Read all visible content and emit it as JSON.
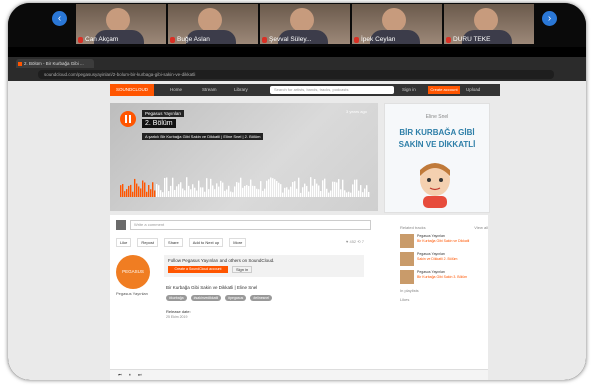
{
  "participants": [
    {
      "name": "Can Akçam"
    },
    {
      "name": "Buğe Aslan"
    },
    {
      "name": "Şevval Süley..."
    },
    {
      "name": "İpek Ceylan"
    },
    {
      "name": "DURU TEKE"
    }
  ],
  "browser": {
    "tab_title": "2. Bölüm - Bir Kurbağa Gibi ...",
    "url": "soundcloud.com/pegasusyayinlari/2-bolum-bir-kurbaga-gibi-sakin-ve-dikkatli"
  },
  "soundcloud": {
    "logo_label": "SOUNDCLOUD",
    "nav": [
      "Home",
      "Stream",
      "Library"
    ],
    "search_placeholder": "Search for artists, bands, tracks, podcasts",
    "signin_label": "Sign in",
    "create_label": "Create account",
    "upload_label": "Upload",
    "track": {
      "artist": "Pegasus Yayınları",
      "title": "2. Bölüm",
      "description": "A şarkılı Bir Kurbağa Gibi Sakin ve Dikkatli | Eline Snel | 2. Bölüm",
      "time_ago": "3 years ago"
    },
    "cover": {
      "author": "Eline Snel",
      "title_line1": "BİR KURBAĞA GİBİ",
      "title_line2": "SAKİN VE DİKKATLİ"
    },
    "comment_placeholder": "Write a comment",
    "actions": [
      "Like",
      "Repost",
      "Share",
      "Add to Next up",
      "More"
    ],
    "stats": "♥ 452  ⟲ 7",
    "uploader": {
      "logo_text": "PEGASUS",
      "name": "Pegasus Yayınları"
    },
    "follow": {
      "prompt": "Follow Pegasus Yayınları and others on SoundCloud.",
      "create_btn": "Create a SoundCloud account",
      "signin": "Sign in"
    },
    "track_desc": "Bir Kurbağa Gibi Sakin ve Dikkatli | Eline Snel",
    "tags": [
      "#kurbağa",
      "#sakinvedikkatli",
      "#pegasus",
      "#elinesnel"
    ],
    "release_label": "Release date:",
    "release_date": "25 Ekim 2019",
    "sidebar": {
      "related_heading": "Related tracks",
      "view_all": "View all",
      "items": [
        {
          "artist": "Pegasus Yayınları",
          "title": "Bir Kurbağa Gibi Sakin ve Dikkatli"
        },
        {
          "artist": "Pegasus Yayınları",
          "title": "Sakin ve Dikkatli 2. Bölüm"
        },
        {
          "artist": "Pegasus Yayınları",
          "title": "Bir Kurbağa Gibi Sakin 3. Bölüm"
        }
      ],
      "playlists_heading": "In playlists",
      "likes_heading": "Likes"
    }
  }
}
